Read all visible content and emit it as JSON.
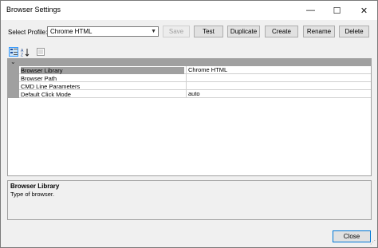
{
  "window": {
    "title": "Browser Settings",
    "minimize": "—",
    "maximize": "☐",
    "close": "✕"
  },
  "profile": {
    "label": "Select Profile:",
    "selected": "Chrome HTML"
  },
  "buttons": {
    "save": "Save",
    "test": "Test",
    "duplicate": "Duplicate",
    "create": "Create",
    "rename": "Rename",
    "delete": "Delete",
    "close": "Close"
  },
  "grid_toolbar": {
    "categorized_icon": "categorized-icon",
    "alphabetical_icon": "alphabetical-icon",
    "property_pages_icon": "property-pages-icon"
  },
  "properties": [
    {
      "name": "Browser Library",
      "value": "Chrome HTML",
      "selected": true
    },
    {
      "name": "Browser Path",
      "value": ""
    },
    {
      "name": "CMD Line Parameters",
      "value": ""
    },
    {
      "name": "Default Click Mode",
      "value": "auto"
    }
  ],
  "description": {
    "title": "Browser Library",
    "text": "Type of browser."
  }
}
